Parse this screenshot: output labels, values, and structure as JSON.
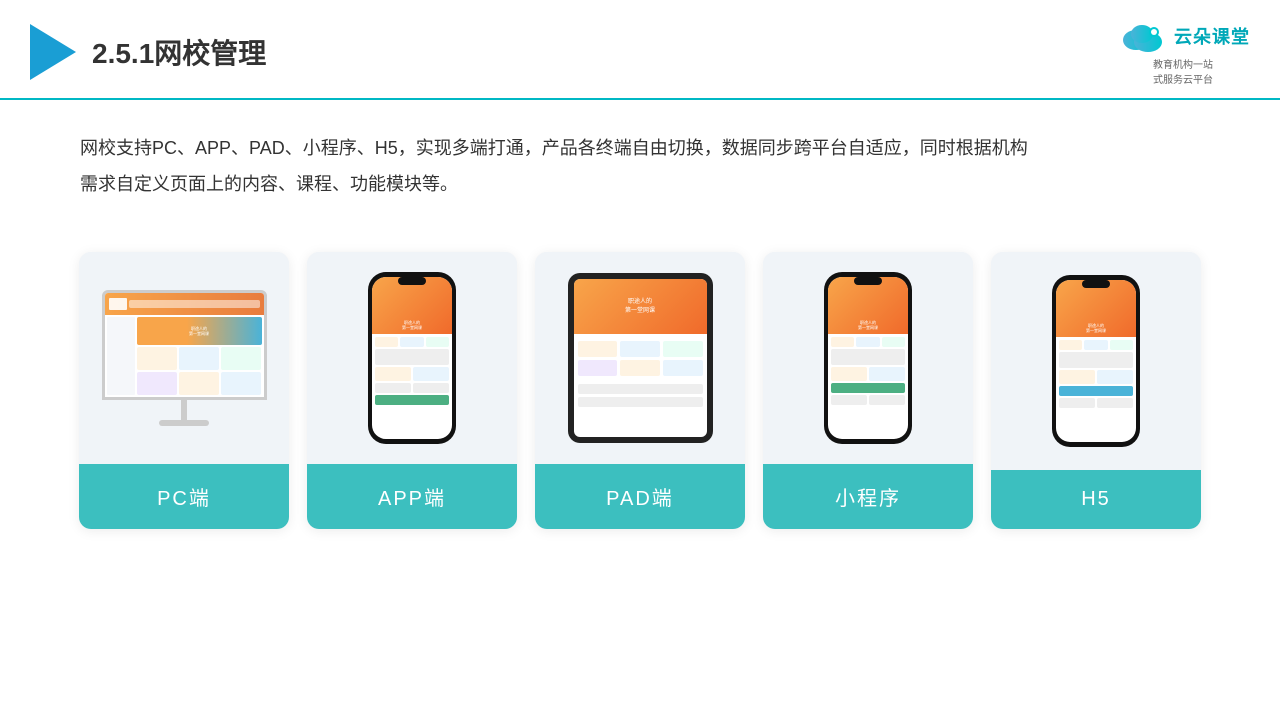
{
  "header": {
    "title": "2.5.1网校管理",
    "logo_name": "云朵课堂",
    "logo_url": "yunduoketang.com",
    "logo_sub": "教育机构一站\n式服务云平台"
  },
  "description": {
    "text": "网校支持PC、APP、PAD、小程序、H5，实现多端打通，产品各终端自由切换，数据同步跨平台自适应，同时根据机构需求自定义页面上的内容、课程、功能模块等。"
  },
  "cards": [
    {
      "id": "pc",
      "label": "PC端",
      "type": "monitor"
    },
    {
      "id": "app",
      "label": "APP端",
      "type": "phone-app"
    },
    {
      "id": "pad",
      "label": "PAD端",
      "type": "tablet"
    },
    {
      "id": "mini",
      "label": "小程序",
      "type": "phone"
    },
    {
      "id": "h5",
      "label": "H5",
      "type": "phone"
    }
  ],
  "colors": {
    "accent": "#3cbfbf",
    "header_line": "#00b8c4",
    "orange": "#f8a54a",
    "blue_light": "#4a90d9",
    "green": "#4caf82",
    "purple": "#9b6bb5",
    "card_bg": "#eef2f6"
  }
}
